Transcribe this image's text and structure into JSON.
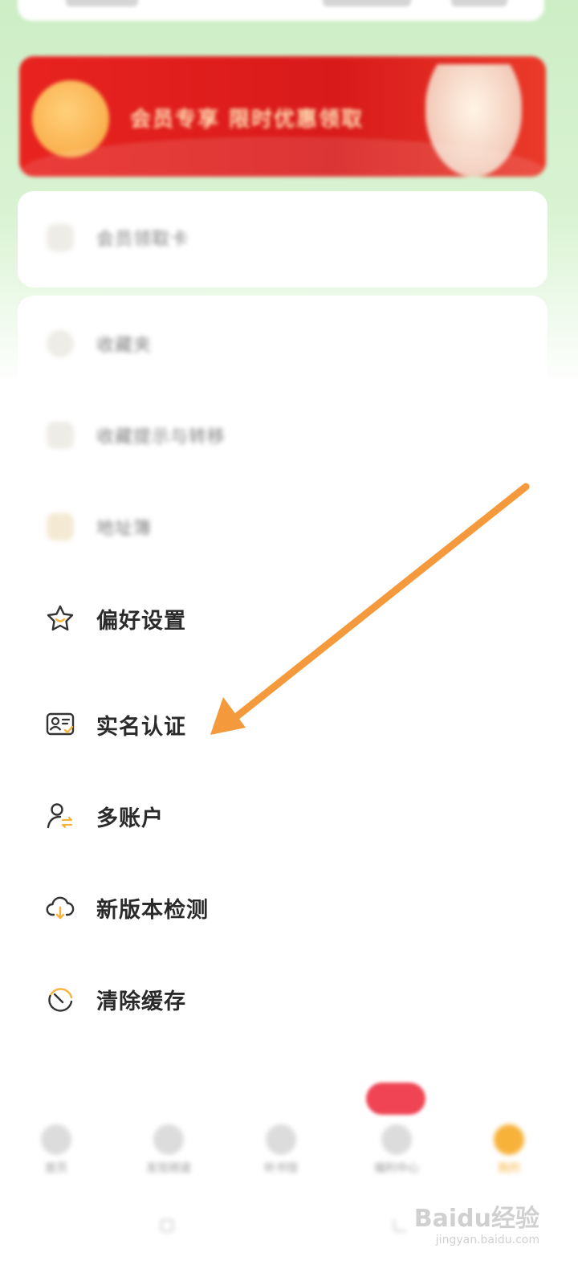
{
  "banner": {
    "headline": "会员专享 限时优惠领取"
  },
  "menu_top": [
    {
      "label": "会员领取卡",
      "icon": "gift-icon"
    }
  ],
  "menu_blurred": [
    {
      "label": "收藏夹",
      "icon": "favorites-icon"
    },
    {
      "label": "收藏提示与转移",
      "icon": "transfer-icon"
    },
    {
      "label": "地址簿",
      "icon": "address-book-icon"
    }
  ],
  "menu": [
    {
      "label": "偏好设置",
      "icon": "star-icon"
    },
    {
      "label": "实名认证",
      "icon": "id-card-verified-icon"
    },
    {
      "label": "多账户",
      "icon": "account-switch-icon"
    },
    {
      "label": "新版本检测",
      "icon": "cloud-download-icon"
    },
    {
      "label": "清除缓存",
      "icon": "clear-cache-icon"
    }
  ],
  "tabbar": [
    {
      "label": "首页"
    },
    {
      "label": "发现频道"
    },
    {
      "label": "听书馆"
    },
    {
      "label": "福利中心"
    },
    {
      "label": "我的"
    }
  ],
  "watermark": {
    "main": "Baidu经验",
    "sub": "jingyan.baidu.com"
  },
  "colors": {
    "accent": "#f7b23a",
    "arrow": "#f59a3c",
    "banner": "#e8231f"
  }
}
